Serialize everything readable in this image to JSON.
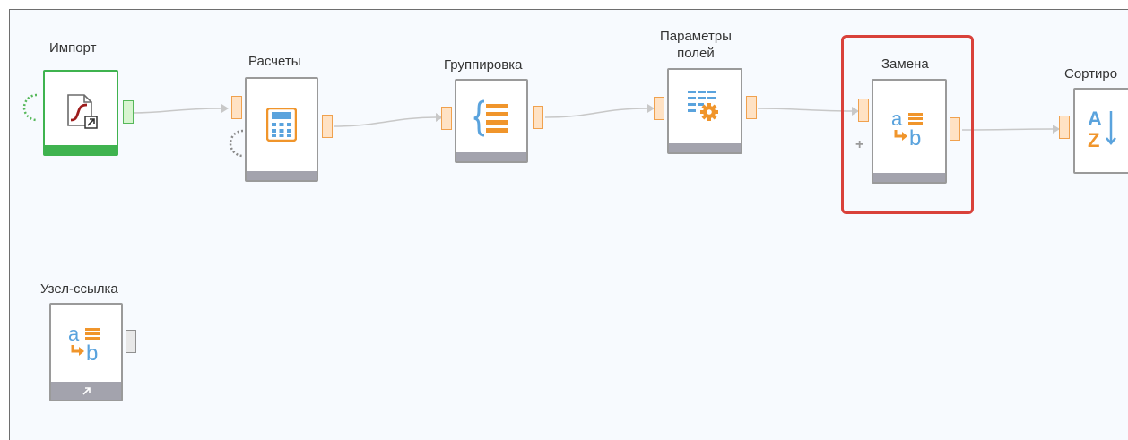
{
  "nodes": {
    "import": {
      "label": "Импорт",
      "icon": "import-icon"
    },
    "calc": {
      "label": "Расчеты",
      "icon": "calculator-icon"
    },
    "group": {
      "label": "Группировка",
      "icon": "grouping-icon"
    },
    "fields": {
      "label_line1": "Параметры",
      "label_line2": "полей",
      "icon": "field-settings-icon"
    },
    "replace": {
      "label": "Замена",
      "icon": "replace-icon"
    },
    "sort": {
      "label": "Сортиро",
      "icon": "sort-az-icon"
    },
    "ref": {
      "label": "Узел-ссылка",
      "icon": "replace-icon"
    }
  },
  "colors": {
    "selection": "#d9413a",
    "port_fill": "#ffe2c4",
    "port_border": "#f0a14e",
    "import_green": "#3fb34f",
    "node_footer": "#a3a3ad",
    "icon_orange": "#f0952b",
    "icon_blue": "#5aa3dd"
  }
}
